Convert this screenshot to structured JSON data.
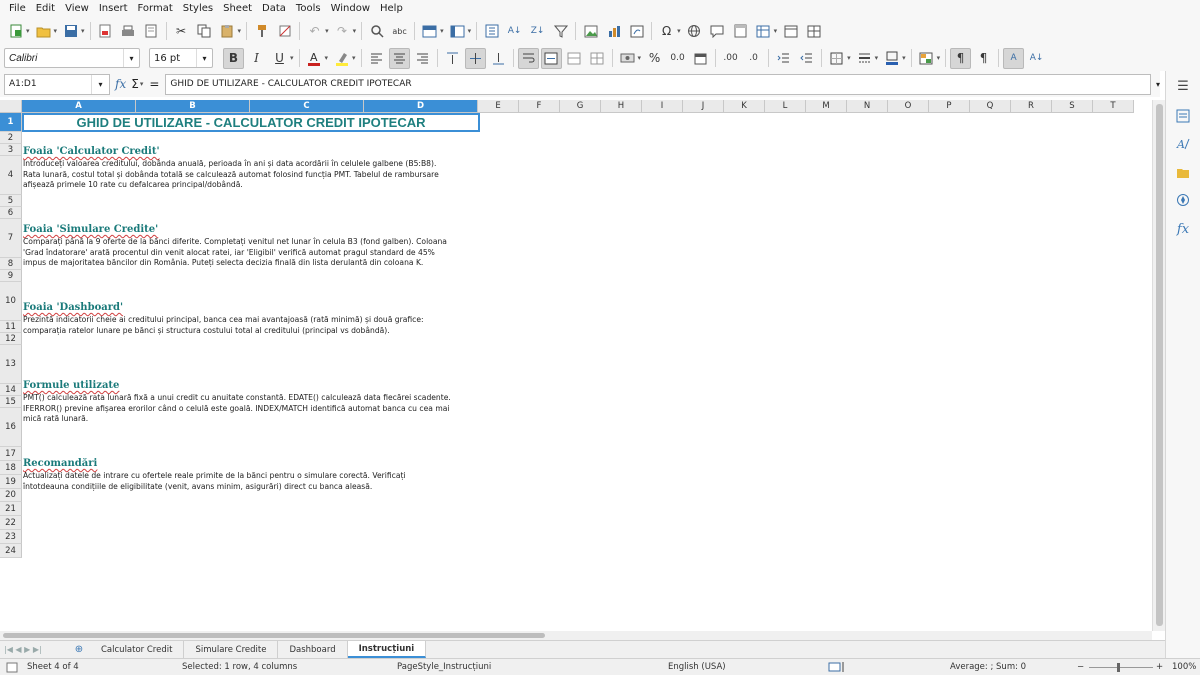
{
  "menu": [
    "File",
    "Edit",
    "View",
    "Insert",
    "Format",
    "Styles",
    "Sheet",
    "Data",
    "Tools",
    "Window",
    "Help"
  ],
  "format_bar": {
    "font_name": "Calibri",
    "font_size": "16 pt"
  },
  "formula_bar": {
    "cell_ref": "A1:D1",
    "sigma": "Σ",
    "equals": "=",
    "content": "GHID DE UTILIZARE - CALCULATOR CREDIT IPOTECAR"
  },
  "columns": [
    "A",
    "B",
    "C",
    "D",
    "E",
    "F",
    "G",
    "H",
    "I",
    "J",
    "K",
    "L",
    "M",
    "N",
    "O",
    "P",
    "Q",
    "R",
    "S",
    "T"
  ],
  "rows": [
    "1",
    "2",
    "3",
    "4",
    "5",
    "6",
    "7",
    "8",
    "9",
    "10",
    "11",
    "12",
    "13",
    "14",
    "15",
    "16",
    "17",
    "18",
    "19",
    "20",
    "21",
    "22",
    "23",
    "24"
  ],
  "content": {
    "title": "GHID DE UTILIZARE - CALCULATOR CREDIT IPOTECAR",
    "sections": [
      {
        "heading": "Foaia 'Calculator Credit'",
        "lines": [
          "Introduceți valoarea creditului, dobânda anuală, perioada în ani și data acordării în celulele galbene (B5:B8).",
          "Rata lunară, costul total și dobânda totală se calculează automat folosind funcția PMT. Tabelul de rambursare",
          "afișează primele 10 rate cu defalcarea principal/dobândă."
        ]
      },
      {
        "heading": "Foaia 'Simulare Credite'",
        "lines": [
          "Comparați până la 9 oferte de la bănci diferite. Completați venitul net lunar în celula B3 (fond galben). Coloana",
          "'Grad îndatorare' arată procentul din venit alocat ratei, iar 'Eligibil' verifică automat pragul standard de 45%",
          "impus de majoritatea băncilor din România. Puteți selecta decizia finală din lista derulantă din coloana K."
        ]
      },
      {
        "heading": "Foaia 'Dashboard'",
        "lines": [
          "Prezintă indicatorii cheie ai creditului principal, banca cea mai avantajoasă (rată minimă) și două grafice:",
          "comparația ratelor lunare pe bănci și structura costului total al creditului (principal vs dobândă)."
        ]
      },
      {
        "heading": "Formule utilizate",
        "lines": [
          "PMT() calculează rata lunară fixă a unui credit cu anuitate constantă. EDATE() calculează data fiecărei scadente.",
          "IFERROR() previne afișarea erorilor când o celulă este goală. INDEX/MATCH identifică automat banca cu cea mai",
          "mică rată lunară."
        ]
      },
      {
        "heading": "Recomandări",
        "lines": [
          "Actualizați datele de intrare cu ofertele reale primite de la bănci pentru o simulare corectă. Verificați",
          "întotdeauna condițiile de eligibilitate (venit, avans minim, asigurări) direct cu banca aleasă."
        ]
      }
    ]
  },
  "sheet_tabs": [
    "Calculator Credit",
    "Simulare Credite",
    "Dashboard",
    "Instrucțiuni"
  ],
  "active_tab": "Instrucțiuni",
  "status": {
    "sheet": "Sheet 4 of 4",
    "selection": "Selected: 1 row, 4 columns",
    "page_style": "PageStyle_Instrucțiuni",
    "language": "English (USA)",
    "summary": "Average: ; Sum: 0",
    "zoom": "100%"
  },
  "colors": {
    "selection": "#3b8fd6",
    "heading": "#1a7a7a",
    "title": "#1e7f7f"
  }
}
